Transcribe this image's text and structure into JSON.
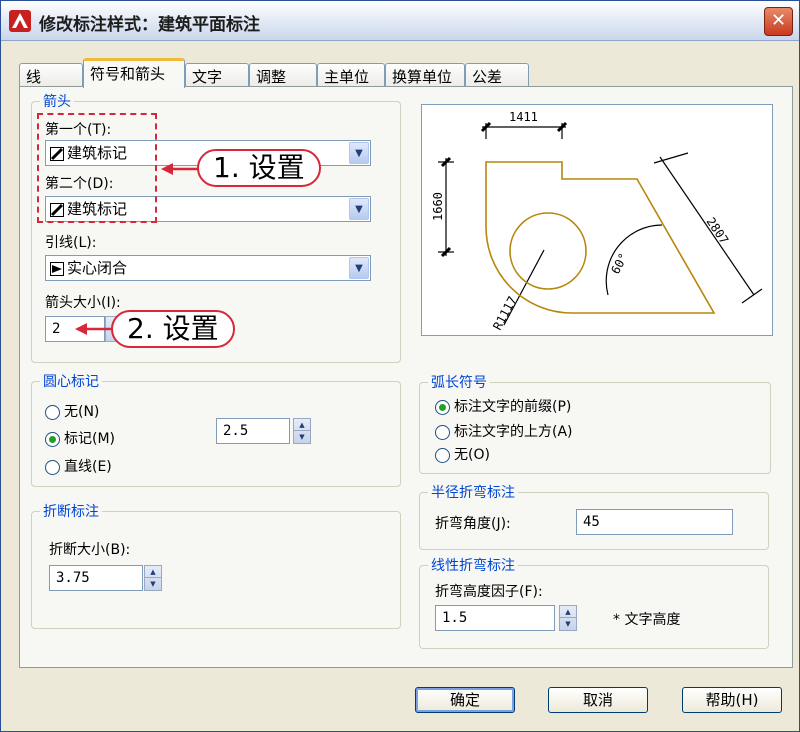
{
  "title": "修改标注样式：建筑平面标注",
  "close_label": "✕",
  "tabs": [
    "线",
    "符号和箭头",
    "文字",
    "调整",
    "主单位",
    "换算单位",
    "公差"
  ],
  "arrows": {
    "group_title": "箭头",
    "first_label": "第一个(T):",
    "first_value": "建筑标记",
    "second_label": "第二个(D):",
    "second_value": "建筑标记",
    "leader_label": "引线(L):",
    "leader_value": "实心闭合",
    "size_label": "箭头大小(I):",
    "size_value": "2"
  },
  "center_mark": {
    "group_title": "圆心标记",
    "options": [
      "无(N)",
      "标记(M)",
      "直线(E)"
    ],
    "selected": 1,
    "size_value": "2.5"
  },
  "break": {
    "group_title": "折断标注",
    "size_label": "折断大小(B):",
    "size_value": "3.75"
  },
  "arc_length": {
    "group_title": "弧长符号",
    "options": [
      "标注文字的前缀(P)",
      "标注文字的上方(A)",
      "无(O)"
    ],
    "selected": 0
  },
  "radius_jog": {
    "group_title": "半径折弯标注",
    "angle_label": "折弯角度(J):",
    "angle_value": "45"
  },
  "linear_jog": {
    "group_title": "线性折弯标注",
    "height_label": "折弯高度因子(F):",
    "height_value": "1.5",
    "unit_label": "* 文字高度"
  },
  "preview": {
    "dim_top": "1411",
    "dim_left": "1660",
    "dim_diag": "2807",
    "dim_angle": "60°",
    "dim_radius": "R1117"
  },
  "callouts": [
    "1. 设置",
    "2. 设置"
  ],
  "buttons": {
    "ok": "确定",
    "cancel": "取消",
    "help": "帮助(H)"
  },
  "colors": {
    "accent_blue": "#0046d5",
    "callout_red": "#d7283a",
    "preview_shape": "#b8860b"
  }
}
